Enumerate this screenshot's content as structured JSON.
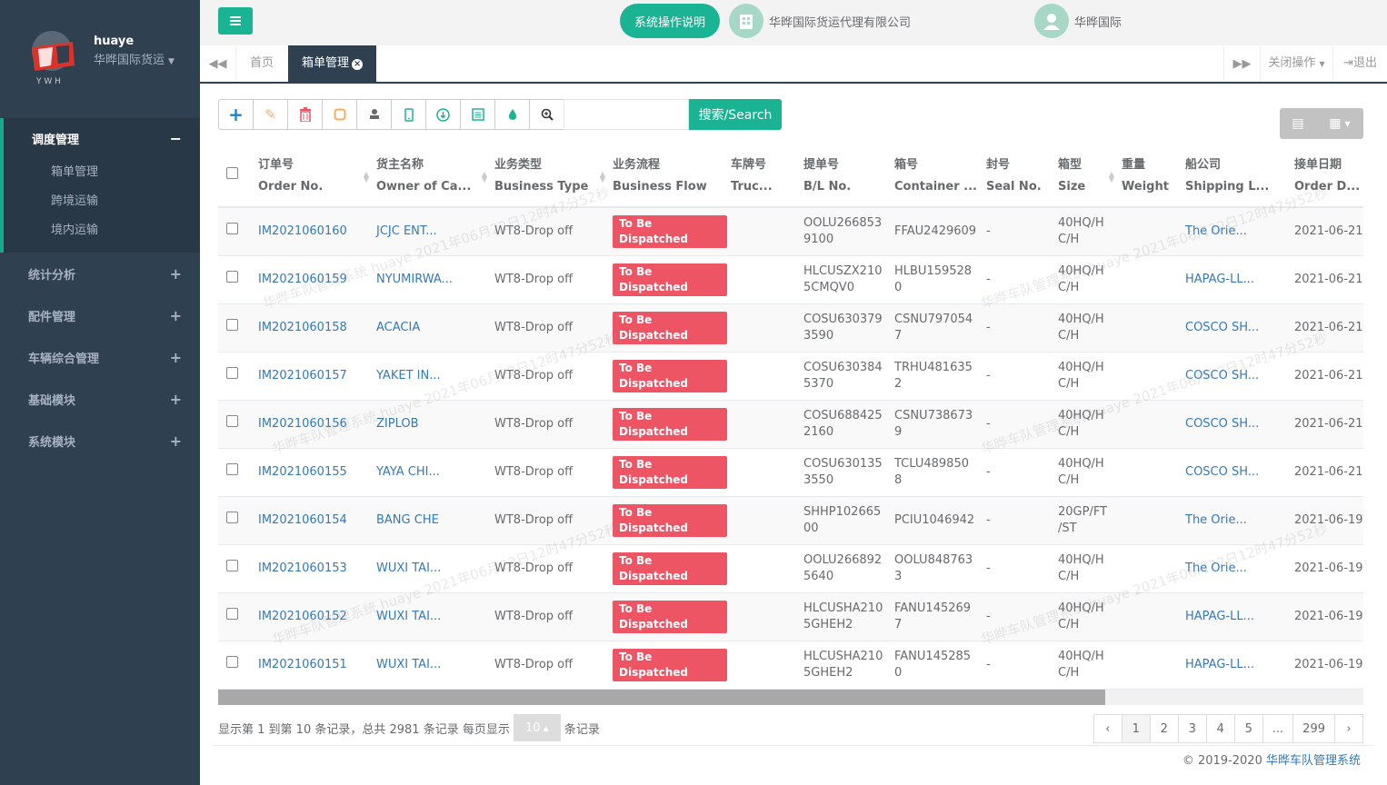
{
  "profile": {
    "name": "huaye",
    "org": "华晔国际货运"
  },
  "sidebar": {
    "items": [
      {
        "label": "调度管理",
        "toggle": "−",
        "children": [
          "箱单管理",
          "跨境运输",
          "境内运输"
        ]
      },
      {
        "label": "统计分析",
        "toggle": "+"
      },
      {
        "label": "配件管理",
        "toggle": "+"
      },
      {
        "label": "车辆综合管理",
        "toggle": "+"
      },
      {
        "label": "基础模块",
        "toggle": "+"
      },
      {
        "label": "系统模块",
        "toggle": "+"
      }
    ]
  },
  "topbar": {
    "guide": "系统操作说明",
    "company": "华晔国际货运代理有限公司",
    "user": "华晔国际"
  },
  "tabs": {
    "home": "首页",
    "active": "箱单管理",
    "close_ops": "关闭操作",
    "logout": "退出"
  },
  "toolbar": {
    "search_label": "搜索/Search",
    "search_value": ""
  },
  "table": {
    "columns": [
      {
        "cn": "订单号",
        "en": "Order No."
      },
      {
        "cn": "货主名称",
        "en": "Owner of Ca..."
      },
      {
        "cn": "业务类型",
        "en": "Business Type"
      },
      {
        "cn": "业务流程",
        "en": "Business Flow"
      },
      {
        "cn": "车牌号",
        "en": "Truc..."
      },
      {
        "cn": "提单号",
        "en": "B/L No."
      },
      {
        "cn": "箱号",
        "en": "Container ..."
      },
      {
        "cn": "封号",
        "en": "Seal No."
      },
      {
        "cn": "箱型",
        "en": "Size"
      },
      {
        "cn": "重量",
        "en": "Weight"
      },
      {
        "cn": "船公司",
        "en": "Shipping L..."
      },
      {
        "cn": "接单日期",
        "en": "Order D..."
      }
    ],
    "rows": [
      {
        "order": "IM2021060160",
        "owner": "JCJC ENT...",
        "type": "WT8-Drop off",
        "flow": "To Be Dispatched",
        "truck": "",
        "bl1": "OOLU266853",
        "bl2": "9100",
        "cn1": "FFAU2429609",
        "cn2": "",
        "seal": "-",
        "size1": "40HQ/H",
        "size2": "C/H",
        "weight": "",
        "ship": "The Orie...",
        "date": "2021-06-21"
      },
      {
        "order": "IM2021060159",
        "owner": "NYUMIRWA...",
        "type": "WT8-Drop off",
        "flow": "To Be Dispatched",
        "truck": "",
        "bl1": "HLCUSZX210",
        "bl2": "5CMQV0",
        "cn1": "HLBU159528",
        "cn2": "0",
        "seal": "-",
        "size1": "40HQ/H",
        "size2": "C/H",
        "weight": "",
        "ship": "HAPAG-LL...",
        "date": "2021-06-21"
      },
      {
        "order": "IM2021060158",
        "owner": "ACACIA",
        "type": "WT8-Drop off",
        "flow": "To Be Dispatched",
        "truck": "",
        "bl1": "COSU630379",
        "bl2": "3590",
        "cn1": "CSNU797054",
        "cn2": "7",
        "seal": "-",
        "size1": "40HQ/H",
        "size2": "C/H",
        "weight": "",
        "ship": "COSCO SH...",
        "date": "2021-06-21"
      },
      {
        "order": "IM2021060157",
        "owner": "YAKET IN...",
        "type": "WT8-Drop off",
        "flow": "To Be Dispatched",
        "truck": "",
        "bl1": "COSU630384",
        "bl2": "5370",
        "cn1": "TRHU481635",
        "cn2": "2",
        "seal": "-",
        "size1": "40HQ/H",
        "size2": "C/H",
        "weight": "",
        "ship": "COSCO SH...",
        "date": "2021-06-21"
      },
      {
        "order": "IM2021060156",
        "owner": "ZIPLOB",
        "type": "WT8-Drop off",
        "flow": "To Be Dispatched",
        "truck": "",
        "bl1": "COSU688425",
        "bl2": "2160",
        "cn1": "CSNU738673",
        "cn2": "9",
        "seal": "-",
        "size1": "40HQ/H",
        "size2": "C/H",
        "weight": "",
        "ship": "COSCO SH...",
        "date": "2021-06-21"
      },
      {
        "order": "IM2021060155",
        "owner": "YAYA CHI...",
        "type": "WT8-Drop off",
        "flow": "To Be Dispatched",
        "truck": "",
        "bl1": "COSU630135",
        "bl2": "3550",
        "cn1": "TCLU489850",
        "cn2": "8",
        "seal": "-",
        "size1": "40HQ/H",
        "size2": "C/H",
        "weight": "",
        "ship": "COSCO SH...",
        "date": "2021-06-21"
      },
      {
        "order": "IM2021060154",
        "owner": "BANG CHE",
        "type": "WT8-Drop off",
        "flow": "To Be Dispatched",
        "truck": "",
        "bl1": "SHHP102665",
        "bl2": "00",
        "cn1": "PCIU1046942",
        "cn2": "",
        "seal": "-",
        "size1": "20GP/FT",
        "size2": "/ST",
        "weight": "",
        "ship": "The Orie...",
        "date": "2021-06-19"
      },
      {
        "order": "IM2021060153",
        "owner": "WUXI TAI...",
        "type": "WT8-Drop off",
        "flow": "To Be Dispatched",
        "truck": "",
        "bl1": "OOLU266892",
        "bl2": "5640",
        "cn1": "OOLU848763",
        "cn2": "3",
        "seal": "-",
        "size1": "40HQ/H",
        "size2": "C/H",
        "weight": "",
        "ship": "The Orie...",
        "date": "2021-06-19"
      },
      {
        "order": "IM2021060152",
        "owner": "WUXI TAI...",
        "type": "WT8-Drop off",
        "flow": "To Be Dispatched",
        "truck": "",
        "bl1": "HLCUSHA210",
        "bl2": "5GHEH2",
        "cn1": "FANU145269",
        "cn2": "7",
        "seal": "-",
        "size1": "40HQ/H",
        "size2": "C/H",
        "weight": "",
        "ship": "HAPAG-LL...",
        "date": "2021-06-19"
      },
      {
        "order": "IM2021060151",
        "owner": "WUXI TAI...",
        "type": "WT8-Drop off",
        "flow": "To Be Dispatched",
        "truck": "",
        "bl1": "HLCUSHA210",
        "bl2": "5GHEH2",
        "cn1": "FANU145285",
        "cn2": "0",
        "seal": "-",
        "size1": "40HQ/H",
        "size2": "C/H",
        "weight": "",
        "ship": "HAPAG-LL...",
        "date": "2021-06-19"
      }
    ]
  },
  "pagination": {
    "info_prefix": "显示第 1 到第 10 条记录，总共 2981 条记录 每页显示",
    "page_size": "10",
    "info_suffix": "条记录",
    "pages": [
      "‹",
      "1",
      "2",
      "3",
      "4",
      "5",
      "...",
      "299",
      "›"
    ]
  },
  "footer": {
    "copyright": "© 2019-2020",
    "system": "华晔车队管理系统"
  },
  "watermark": "华晔车队管理系统 huaye 2021年06月22日12时47分52秒",
  "colors": {
    "accent": "#1ab394",
    "sidebar": "#2f4050",
    "flow_badge": "#ed5565",
    "link": "#337ab7"
  }
}
